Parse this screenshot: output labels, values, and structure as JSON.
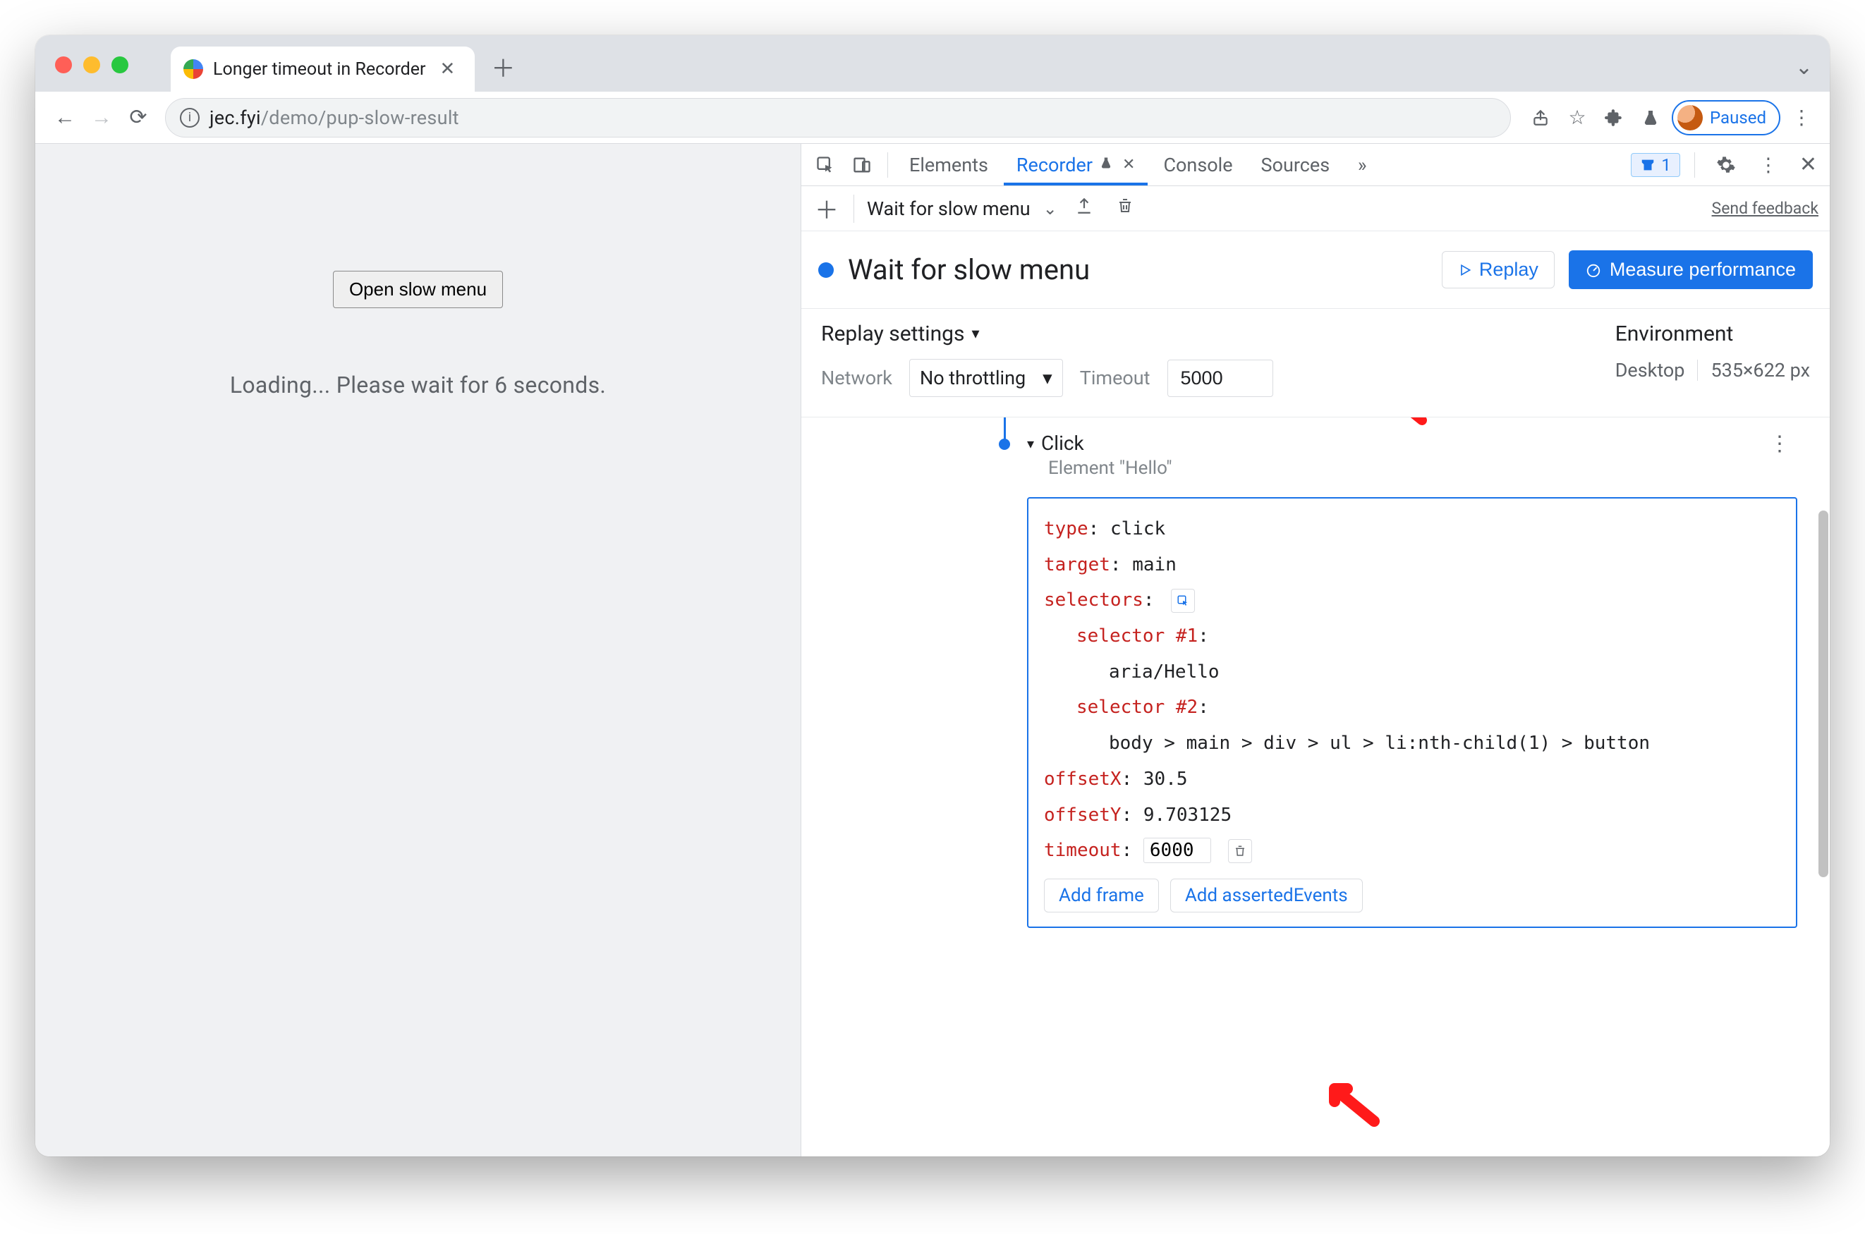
{
  "browser": {
    "tab_title": "Longer timeout in Recorder",
    "url_host": "jec.fyi",
    "url_path": "/demo/pup-slow-result",
    "paused_label": "Paused"
  },
  "page": {
    "button_label": "Open slow menu",
    "loading_text": "Loading... Please wait for 6 seconds."
  },
  "devtools": {
    "tabs": {
      "elements": "Elements",
      "recorder": "Recorder",
      "console": "Console",
      "sources": "Sources"
    },
    "issues_count": "1",
    "rec_top": {
      "name": "Wait for slow menu",
      "feedback": "Send feedback"
    },
    "rec_title": {
      "title": "Wait for slow menu",
      "replay": "Replay",
      "measure": "Measure performance"
    },
    "settings": {
      "header": "Replay settings",
      "network_label": "Network",
      "network_value": "No throttling",
      "timeout_label": "Timeout",
      "timeout_value": "5000",
      "env_header": "Environment",
      "env_device": "Desktop",
      "env_size": "535×622 px"
    },
    "step": {
      "name": "Click",
      "subtitle": "Element \"Hello\"",
      "type_key": "type",
      "type_val": "click",
      "target_key": "target",
      "target_val": "main",
      "selectors_key": "selectors",
      "selector1_key": "selector #1",
      "selector1_val": "aria/Hello",
      "selector2_key": "selector #2",
      "selector2_val": "body > main > div > ul > li:nth-child(1) > button",
      "offsetx_key": "offsetX",
      "offsetx_val": "30.5",
      "offsety_key": "offsetY",
      "offsety_val": "9.703125",
      "timeout_key": "timeout",
      "timeout_val": "6000",
      "add_frame": "Add frame",
      "add_asserted": "Add assertedEvents"
    }
  }
}
